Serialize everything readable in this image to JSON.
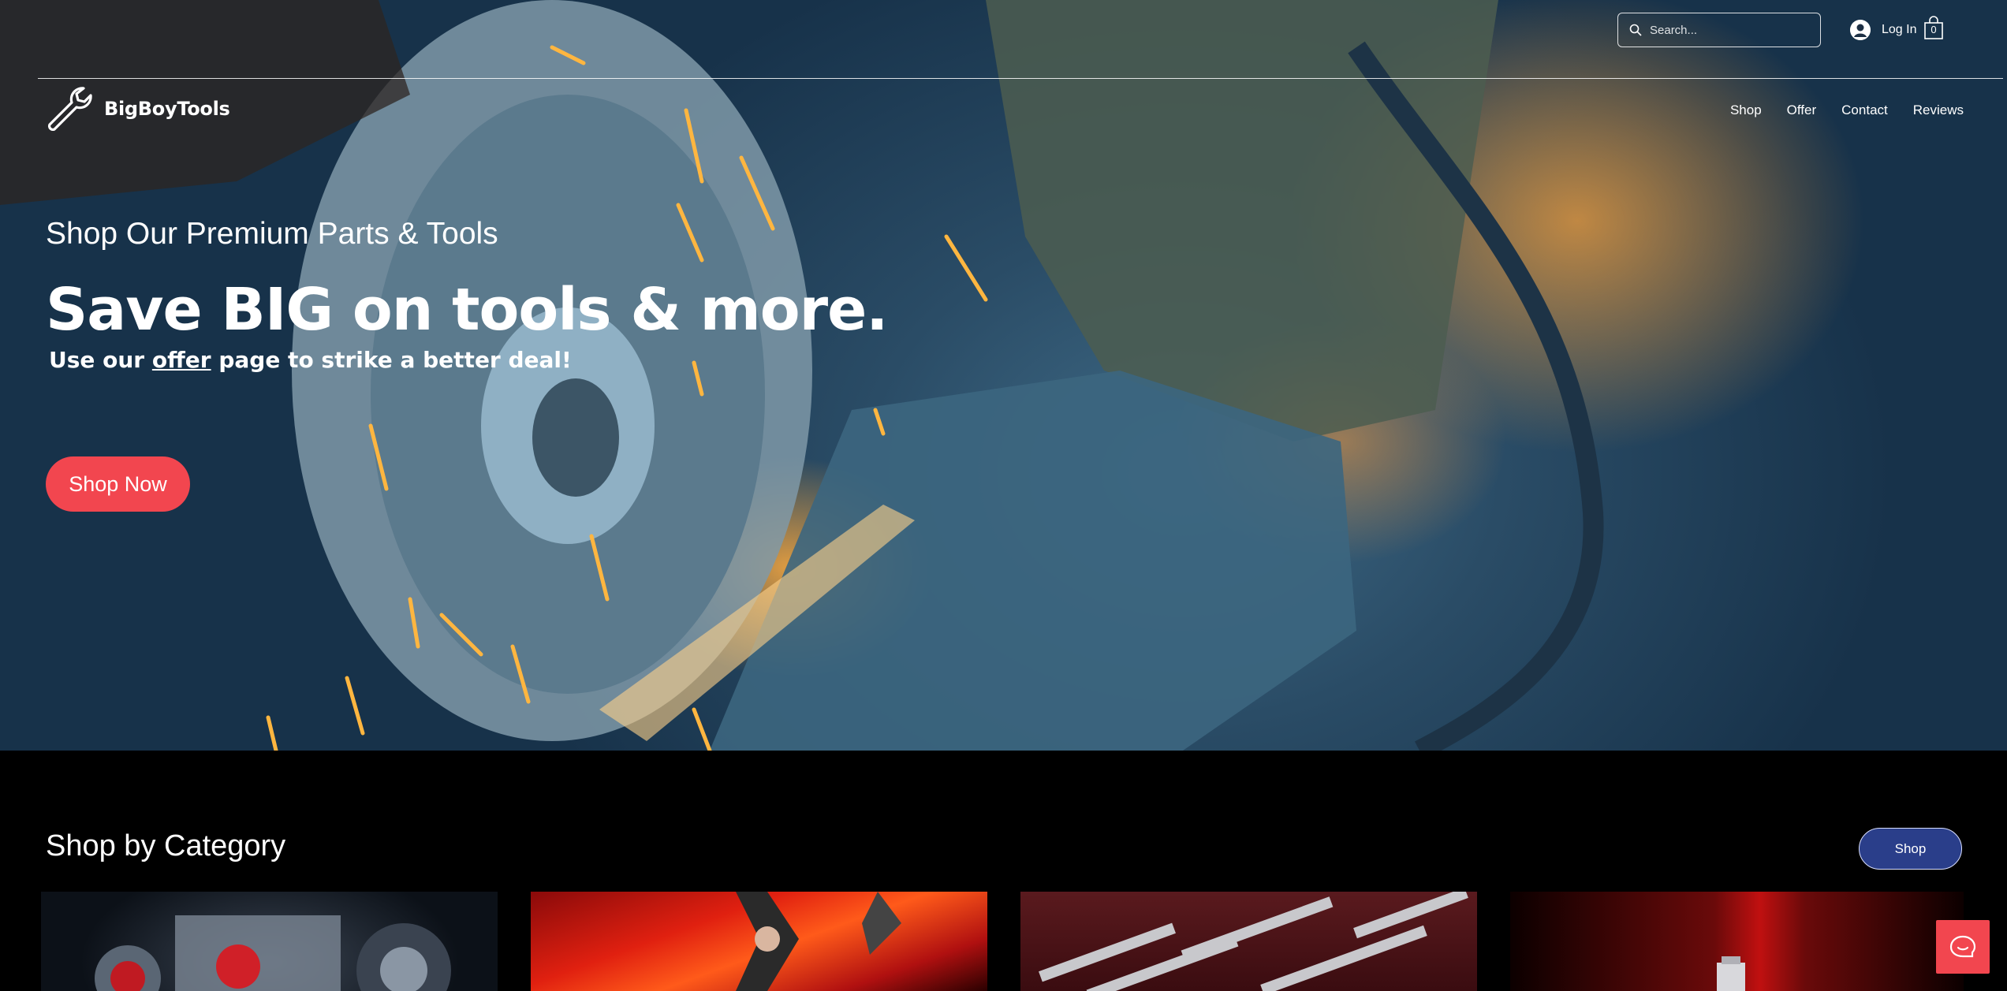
{
  "header": {
    "search_placeholder": "Search...",
    "login_label": "Log In",
    "cart_count": "0",
    "brand": "BigBoyTools",
    "nav": [
      "Shop",
      "Offer",
      "Contact",
      "Reviews"
    ]
  },
  "hero": {
    "eyebrow": "Shop Our Premium Parts & Tools",
    "headline": "Save BIG on tools & more.",
    "sub_before": "Use our ",
    "sub_link": "offer",
    "sub_after": " page to strike a better deal!",
    "cta": "Shop Now"
  },
  "categories": {
    "title": "Shop by Category",
    "shop_button": "Shop"
  },
  "colors": {
    "accent": "#f2464f",
    "shop_button": "#2a3e8a",
    "background": "#000000"
  },
  "icons": [
    "search-icon",
    "user-icon",
    "cart-icon",
    "wrench-icon",
    "chat-icon"
  ]
}
